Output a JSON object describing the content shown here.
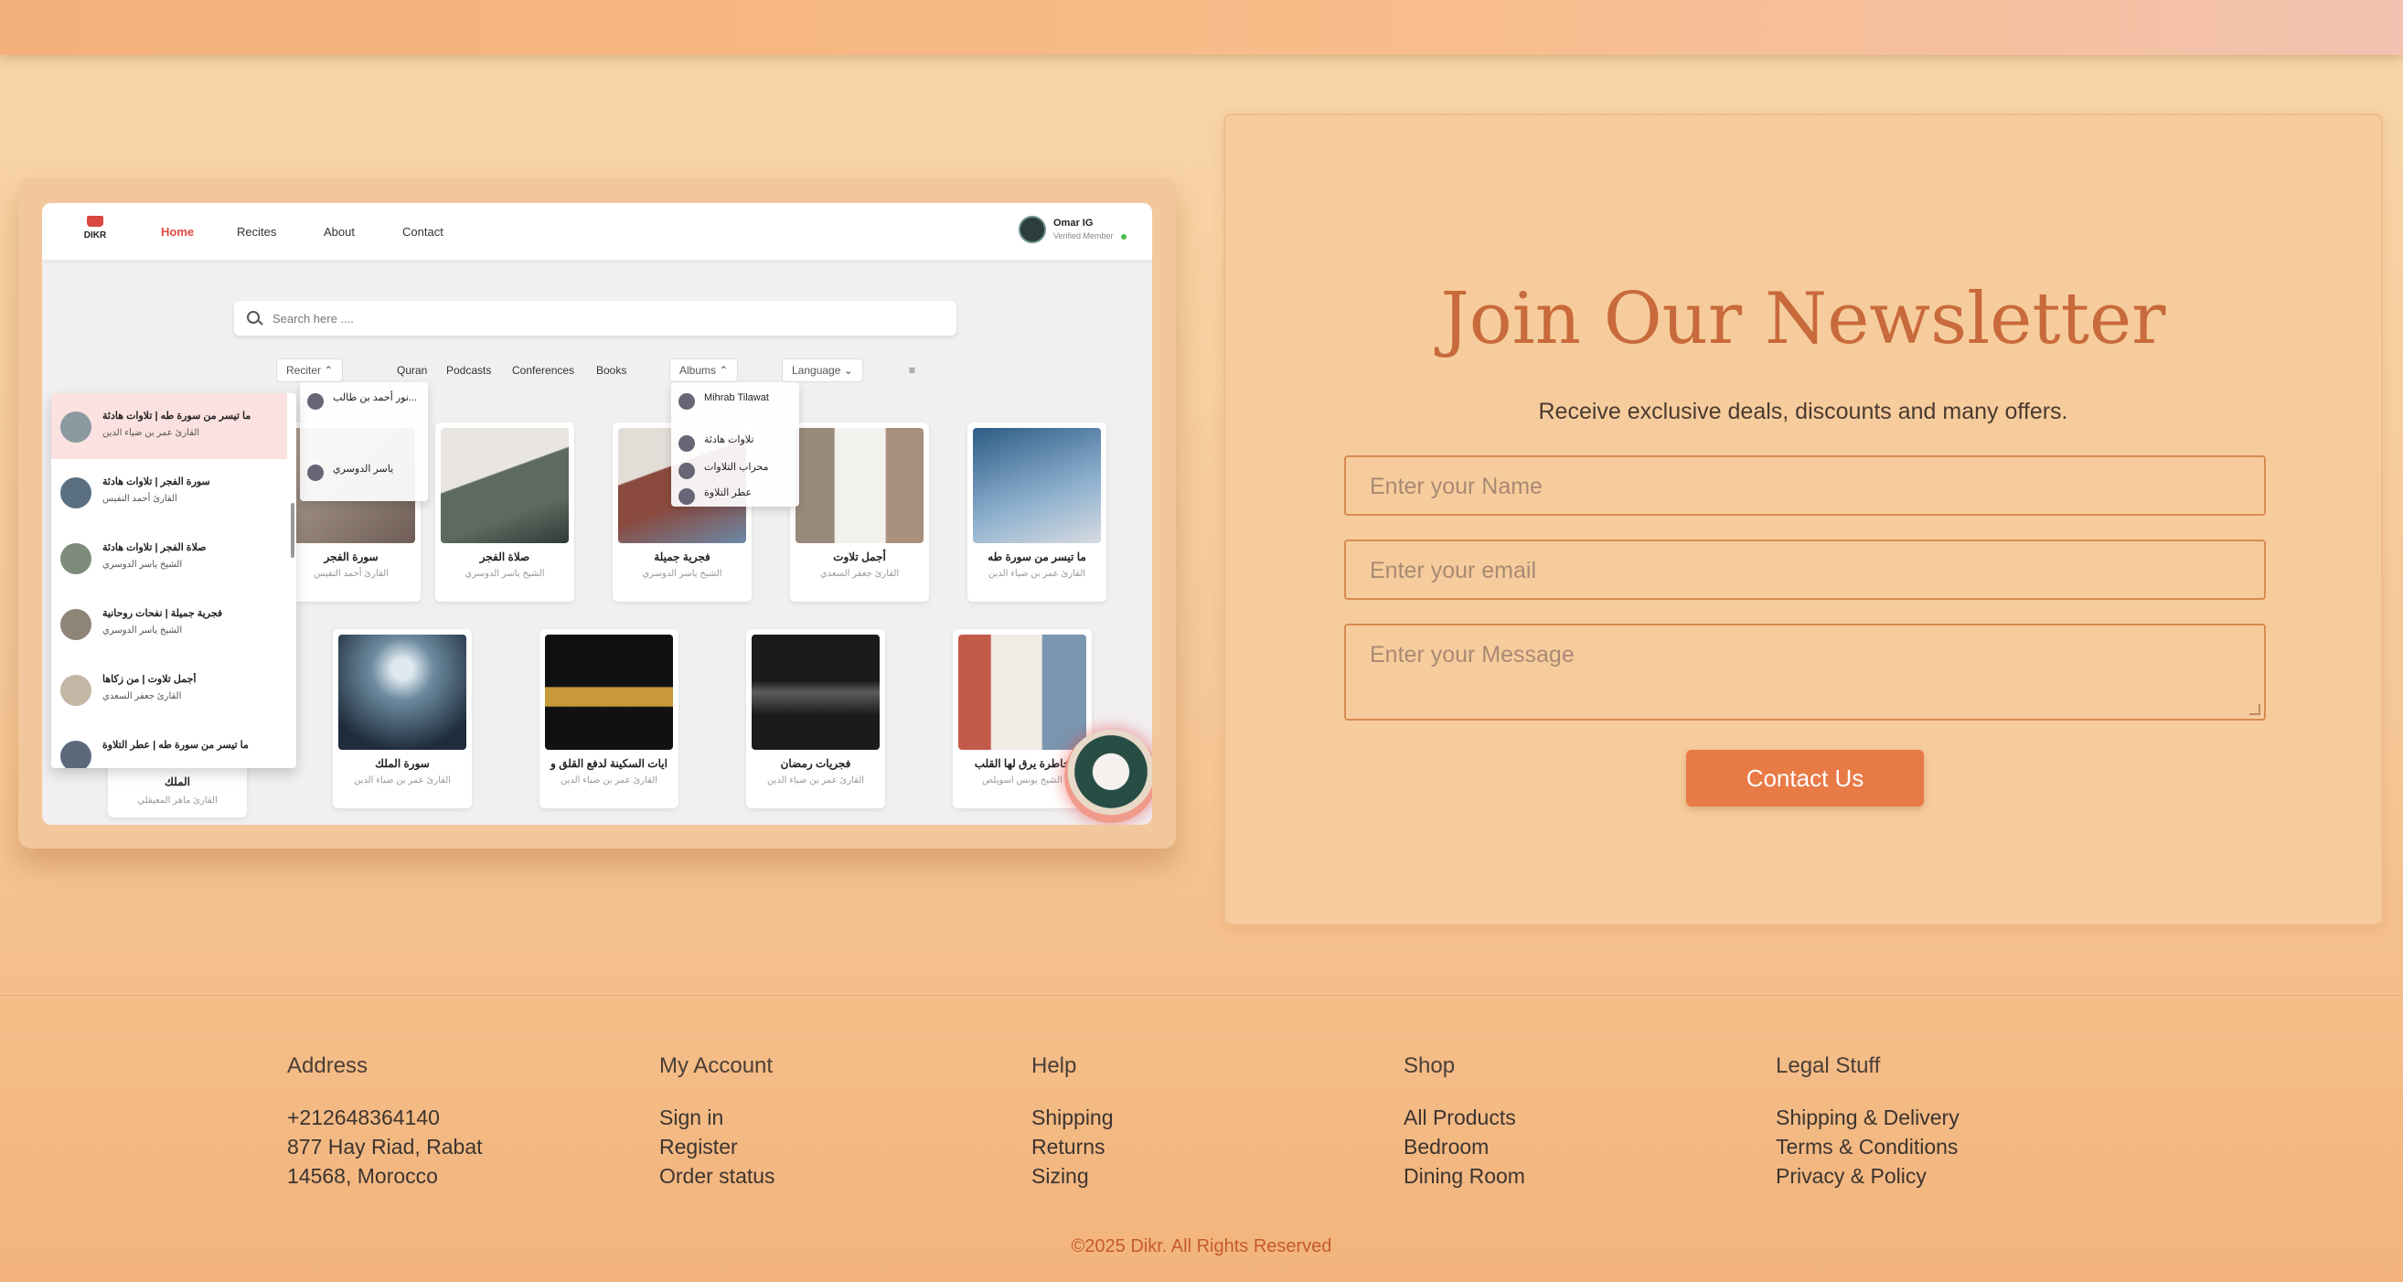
{
  "preview": {
    "logo_text": "DIKR",
    "nav": [
      "Home",
      "Recites",
      "About",
      "Contact"
    ],
    "user_name": "Omar IG",
    "user_role": "Verified Member",
    "search_placeholder": "Search here ....",
    "filters": {
      "reciter": "Reciter",
      "tabs": [
        "Quran",
        "Podcasts",
        "Conferences",
        "Books"
      ],
      "albums": "Albums",
      "language": "Language",
      "sort_icon": "sort-icon"
    },
    "cards_row1": [
      {
        "title": "سورة الفجر",
        "sub": "القارئ أحمد النفيس"
      },
      {
        "title": "صلاة الفجر",
        "sub": "الشيخ ياسر الدوسري"
      },
      {
        "title": "فجرية جميلة",
        "sub": "الشيخ ياسر الدوسري"
      },
      {
        "title": "أجمل تلاوت",
        "sub": "القارئ جعفر السعدي"
      },
      {
        "title": "ما تيسر من سورة طه",
        "sub": "القارئ عمر بن ضياء الدين"
      }
    ],
    "cards_row2": [
      {
        "title": "سورة الملك",
        "sub": "القارئ عمر بن ضياء الدين"
      },
      {
        "title": "ايات السكينة لدفع القلق و",
        "sub": "القارئ عمر بن ضياء الدين"
      },
      {
        "title": "فجريات رمضان",
        "sub": "القارئ عمر بن ضياء الدين"
      },
      {
        "title": "خاطرة يرق لها القلب",
        "sub": "الشيخ يونس اسويلص"
      }
    ],
    "hidden_card": {
      "title": "الملك",
      "sub": "القارئ ماهر المعيقلي"
    },
    "reciter_list": [
      {
        "title": "ما تيسر من سورة طه | تلاوات هادئة",
        "sub": "القارئ عمر بن ضياء الدين"
      },
      {
        "title": "سورة الفجر | تلاوات هادئة",
        "sub": "القارئ أحمد النفيس"
      },
      {
        "title": "صلاة الفجر | تلاوات هادئة",
        "sub": "الشيخ ياسر الدوسري"
      },
      {
        "title": "فجرية جميلة | نفحات روحانية",
        "sub": "الشيخ ياسر الدوسري"
      },
      {
        "title": "أجمل تلاوت | من زكاها",
        "sub": "القارئ جعفر السعدي"
      },
      {
        "title": "ما تيسر من سورة طه | عطر التلاوة",
        "sub": ""
      }
    ],
    "reciter_small": [
      "نور أحمد بن طالب...",
      "ياسر الدوسري"
    ],
    "albums_list": [
      "Mihrab Tilawat",
      "تلاوات هادئة",
      "محراب التلاوات",
      "عطر التلاوة"
    ]
  },
  "newsletter": {
    "title": "Join Our Newsletter",
    "subtitle": "Receive exclusive deals, discounts and many offers.",
    "name_placeholder": "Enter your Name",
    "email_placeholder": "Enter your email",
    "message_placeholder": "Enter your Message",
    "button": "Contact Us"
  },
  "footer": {
    "columns": [
      {
        "heading": "Address",
        "items": [
          "+212648364140",
          "877 Hay Riad, Rabat",
          "14568, Morocco"
        ]
      },
      {
        "heading": "My Account",
        "items": [
          "Sign in",
          "Register",
          "Order status"
        ]
      },
      {
        "heading": "Help",
        "items": [
          "Shipping",
          "Returns",
          "Sizing"
        ]
      },
      {
        "heading": "Shop",
        "items": [
          "All Products",
          "Bedroom",
          "Dining Room"
        ]
      },
      {
        "heading": "Legal Stuff",
        "items": [
          "Shipping & Delivery",
          "Terms & Conditions",
          "Privacy & Policy"
        ]
      }
    ],
    "copyright": "©2025 Dikr. All Rights Reserved"
  },
  "colors": {
    "accent": "#e87a46",
    "title": "#c86a3b",
    "copyright": "#c65a2f"
  }
}
